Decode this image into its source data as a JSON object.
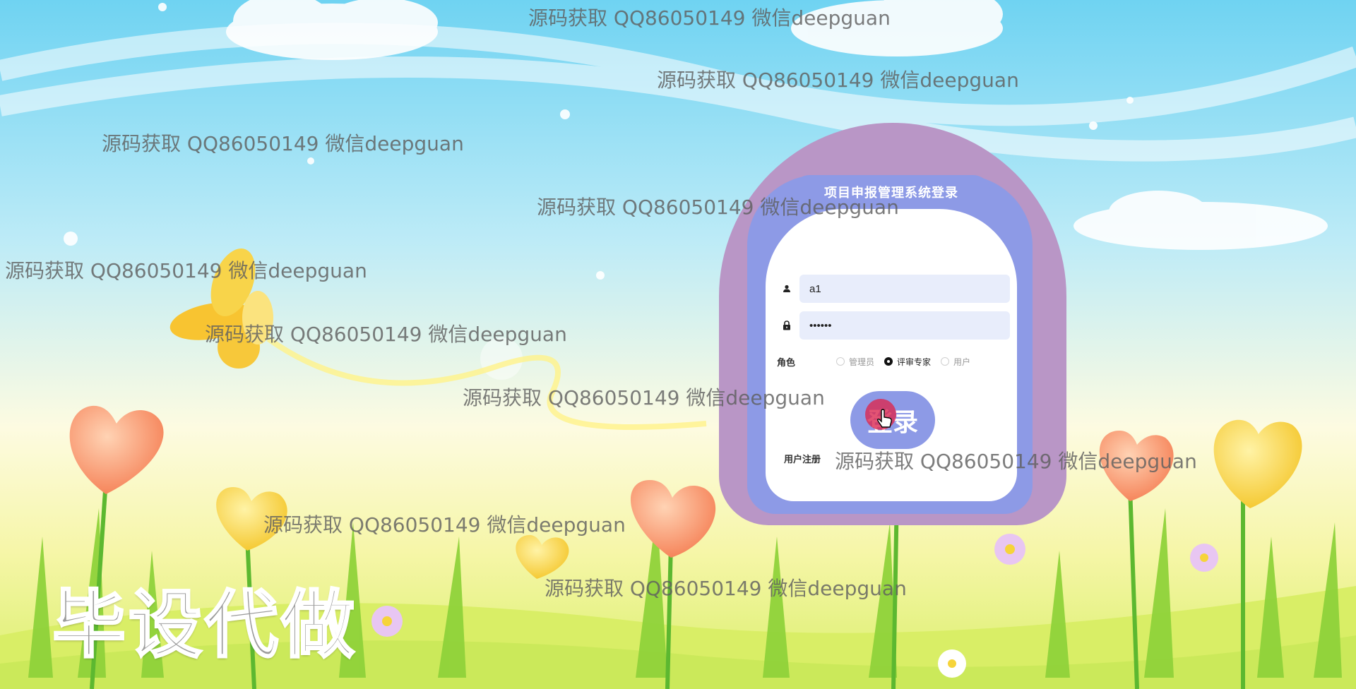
{
  "login": {
    "title": "项目申报管理系统登录",
    "username_value": "a1",
    "password_value": "••••••",
    "role_label": "角色",
    "roles": [
      "管理员",
      "评审专家",
      "用户"
    ],
    "selected_role": "评审专家",
    "login_button": "登录",
    "register_link": "用户注册"
  },
  "watermark_text": "源码获取 QQ86050149 微信deepguan",
  "promo_text": "毕设代做",
  "colors": {
    "sky_top": "#6fd3f2",
    "outer_frame": "#b996c6",
    "inner_frame": "#8d9ae6",
    "input_bg": "#e8edfb"
  },
  "icons": [
    "user-icon",
    "lock-icon",
    "cursor-icon"
  ]
}
